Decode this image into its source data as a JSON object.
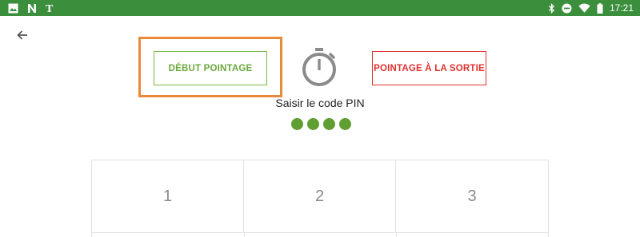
{
  "status_bar": {
    "left_icons": [
      "image-icon",
      "n-app-icon",
      "nyt-icon"
    ],
    "right_icons": [
      "bluetooth-icon",
      "do-not-disturb-icon",
      "wifi-icon",
      "battery-icon"
    ],
    "time": "17:21",
    "background_color": "#3b8f3c"
  },
  "nav": {
    "back_icon": "arrow-left-icon"
  },
  "actions": {
    "start_label": "DÉBUT POINTAGE",
    "exit_label": "POINTAGE À LA SORTIE",
    "start_color": "#6aa83c",
    "exit_color": "#e0312e",
    "highlight_color": "#e88a3a"
  },
  "timer_icon": "stopwatch-icon",
  "pin": {
    "label": "Saisir le code PIN",
    "filled_digits": 4,
    "dot_color": "#5f9e32"
  },
  "keypad": {
    "keys": [
      "1",
      "2",
      "3"
    ]
  }
}
